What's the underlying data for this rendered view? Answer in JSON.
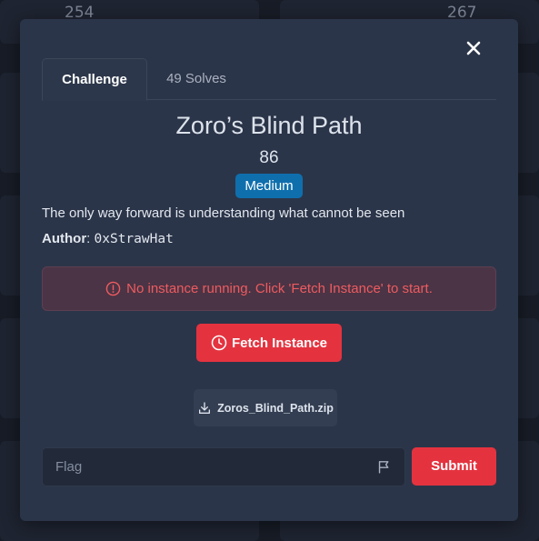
{
  "background": {
    "card_numbers": [
      "254",
      "267"
    ]
  },
  "modal": {
    "close_icon": "close-icon",
    "tabs": [
      {
        "label": "Challenge",
        "active": true
      },
      {
        "label": "49 Solves",
        "active": false
      }
    ],
    "challenge": {
      "title": "Zoro’s Blind Path",
      "points": "86",
      "difficulty": "Medium",
      "description": "The only way forward is understanding what cannot be seen",
      "author_label": "Author",
      "author_name": "0xStrawHat"
    },
    "alert": {
      "icon": "info-icon",
      "message": "No instance running. Click 'Fetch Instance' to start."
    },
    "fetch_button": {
      "icon": "clock-icon",
      "label": "Fetch Instance"
    },
    "file": {
      "icon": "download-icon",
      "name": "Zoros_Blind_Path.zip"
    },
    "flag_form": {
      "placeholder": "Flag",
      "value": "",
      "icon": "flag-icon",
      "submit_label": "Submit"
    }
  },
  "colors": {
    "modal_bg": "#2b3549",
    "accent_red": "#e4333f",
    "badge_blue": "#0f6fad",
    "alert_text": "#ee5b60"
  }
}
